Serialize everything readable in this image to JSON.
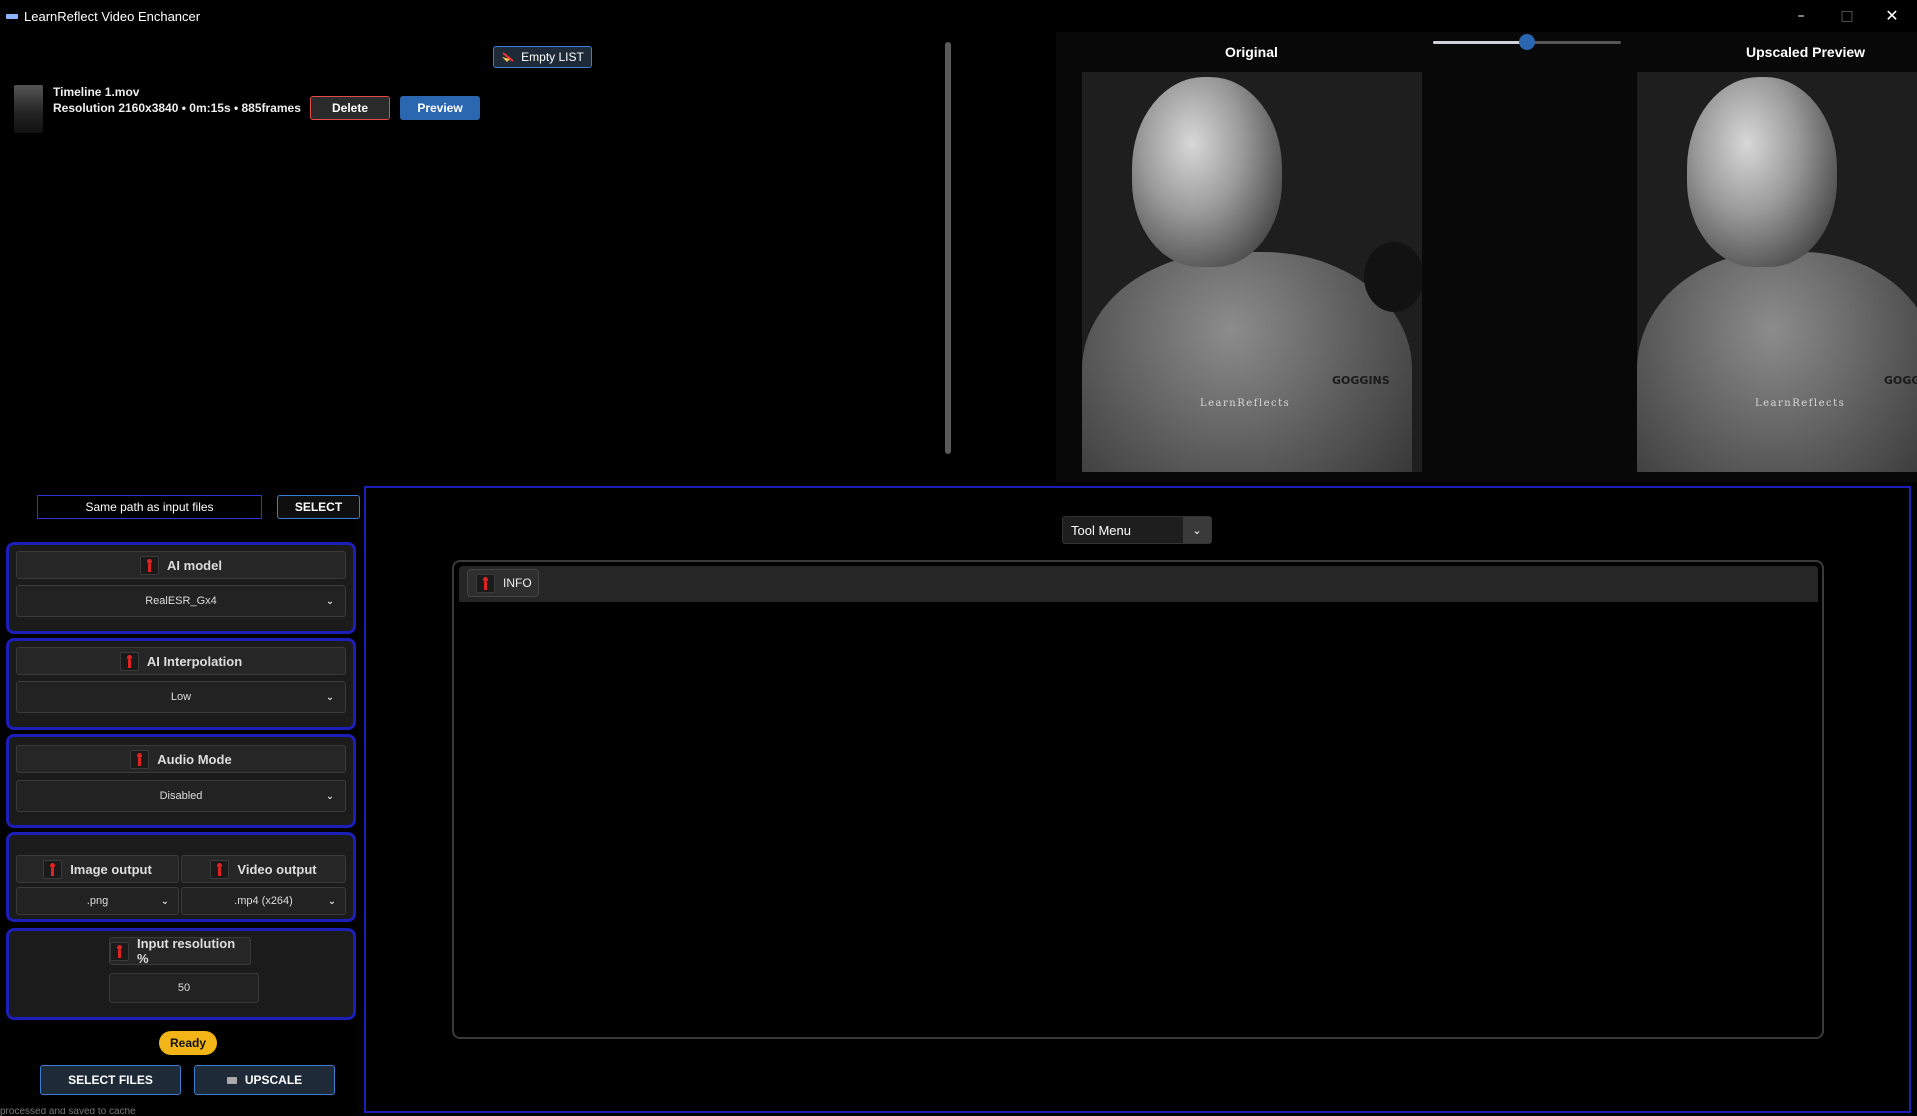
{
  "window": {
    "title": "LearnReflect Video Enchancer",
    "minimize": "–",
    "maximize": "□",
    "close": "✕"
  },
  "file_list": {
    "empty_button": "Empty LIST",
    "items": [
      {
        "name": "Timeline 1.mov",
        "meta": "Resolution 2160x3840 • 0m:15s • 885frames",
        "delete_label": "Delete",
        "preview_label": "Preview"
      }
    ]
  },
  "preview": {
    "original_label": "Original",
    "upscaled_label": "Upscaled Preview",
    "compare_slider_value": 0.5,
    "watermark": "LearnReflects",
    "brand_text": "GOGGINS"
  },
  "output_path": {
    "value": "Same path as input files",
    "select_label": "SELECT"
  },
  "settings": {
    "ai_model": {
      "label": "AI model",
      "value": "RealESR_Gx4"
    },
    "ai_interpolation": {
      "label": "AI Interpolation",
      "value": "Low"
    },
    "audio_mode": {
      "label": "Audio Mode",
      "value": "Disabled"
    },
    "image_output": {
      "label": "Image output",
      "value": ".png"
    },
    "video_output": {
      "label": "Video output",
      "value": ".mp4 (x264)"
    },
    "input_resolution": {
      "label": "Input resolution %",
      "value": "50"
    }
  },
  "status": "Ready",
  "actions": {
    "select_files": "SELECT FILES",
    "upscale": "UPSCALE"
  },
  "console_text": "processed and saved to cache",
  "tool_menu": {
    "label": "Tool Menu"
  },
  "info_panel": {
    "tab_label": "INFO"
  },
  "colors": {
    "accent_blue": "#2b67b1",
    "panel_border": "#1c1eb8",
    "status_yellow": "#f3b417",
    "delete_red": "#e74848"
  }
}
